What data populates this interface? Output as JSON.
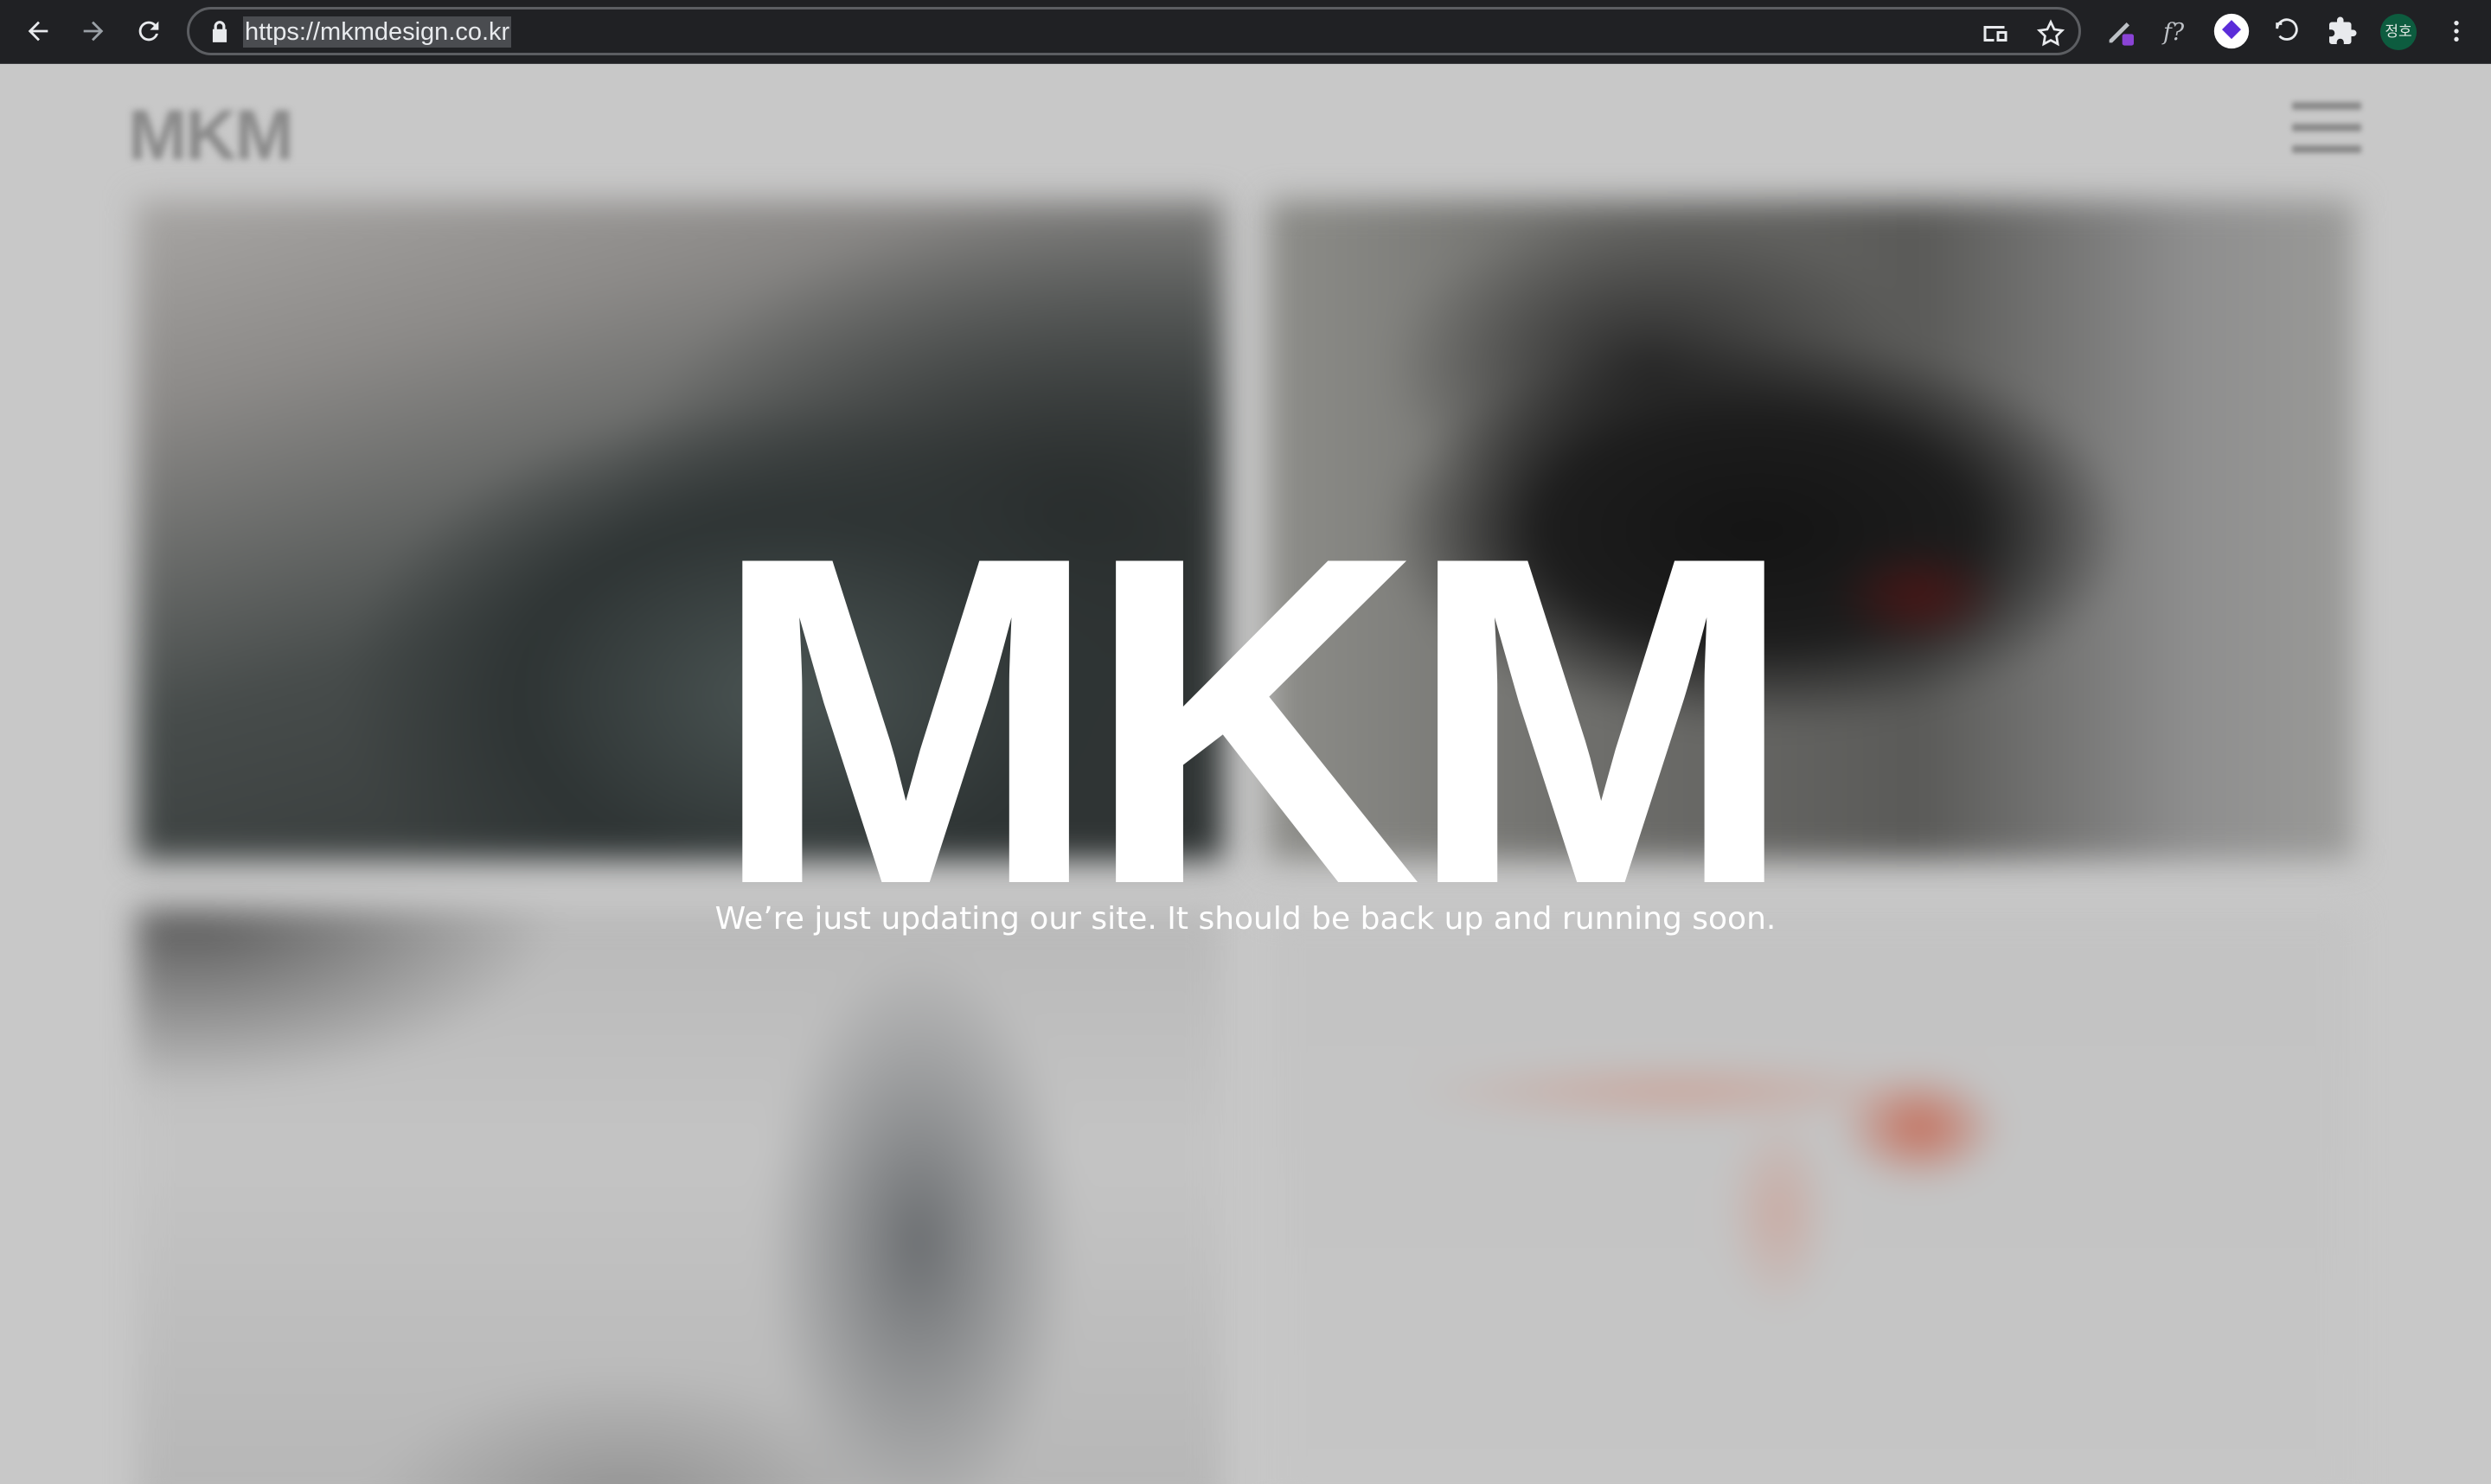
{
  "browser": {
    "url": "https://mkmdesign.co.kr",
    "profile_initials": "정호"
  },
  "site": {
    "logo": "MKM",
    "hero_title": "MKM",
    "hero_subtitle": "We’re just updating our site. It should be back up and running soon."
  },
  "icons": {
    "back": "arrow-left-icon",
    "forward": "arrow-right-icon",
    "reload": "reload-icon",
    "lock": "lock-icon",
    "cast": "cast-icon",
    "bookmark": "star-icon",
    "menu": "hamburger-icon"
  },
  "colors": {
    "chrome_bg": "#202124",
    "page_bg": "#c8c8c8",
    "hero_text": "#ffffff"
  }
}
